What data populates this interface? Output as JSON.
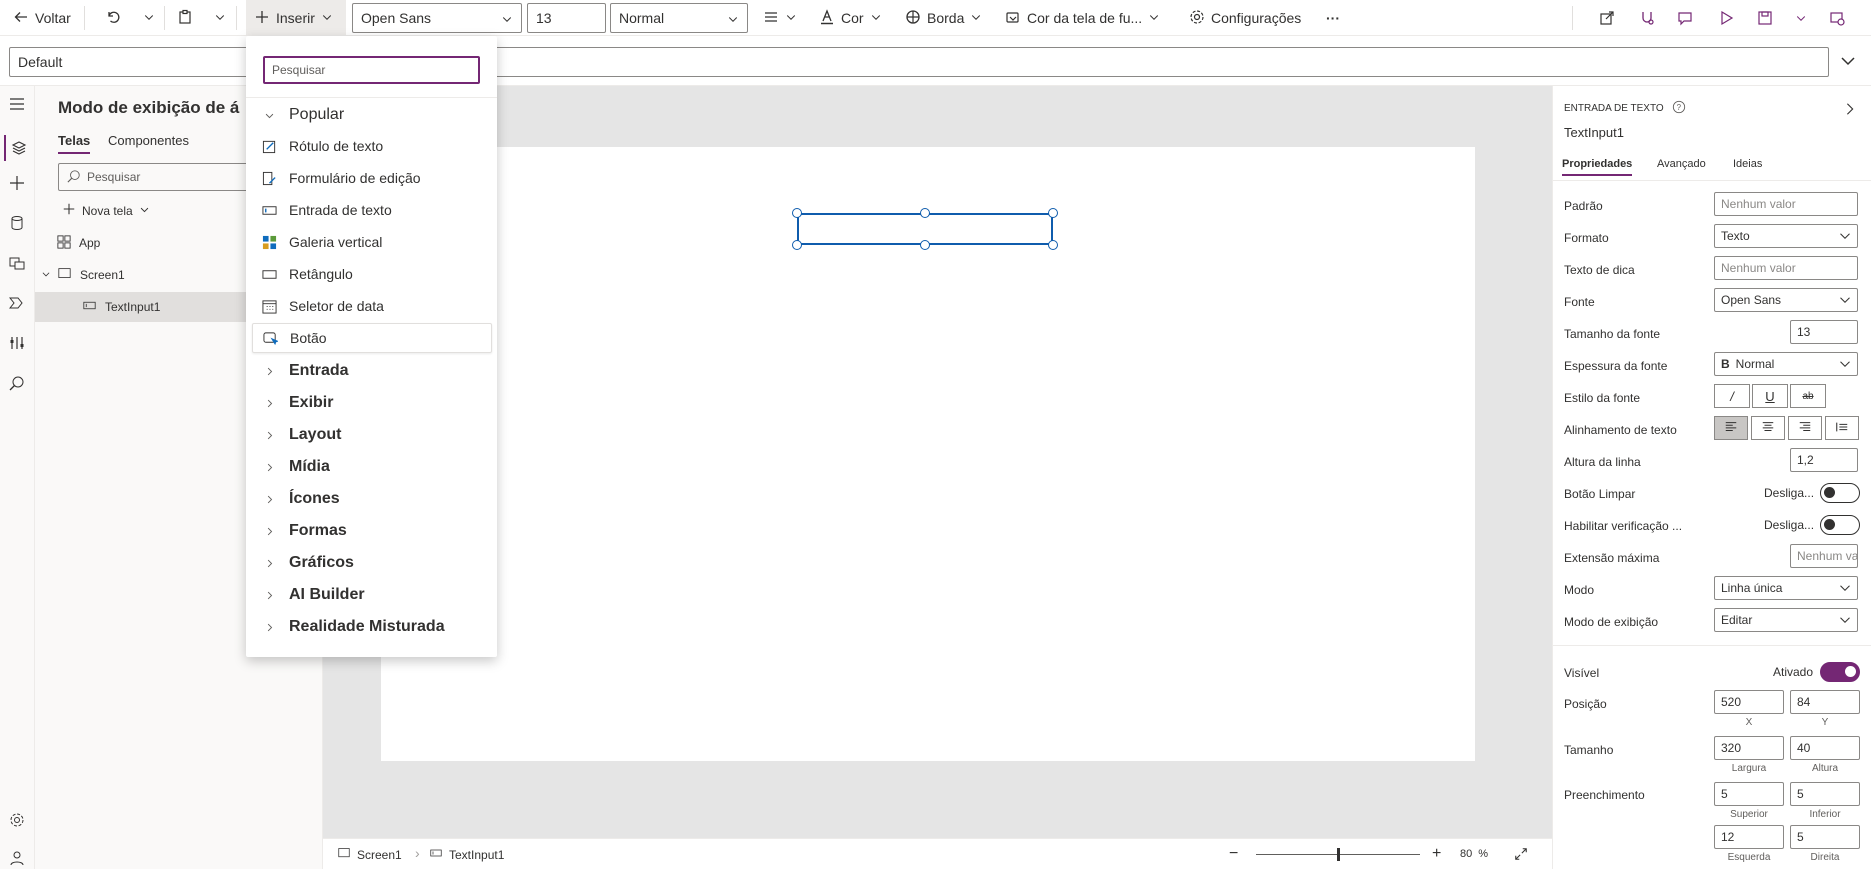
{
  "toolbar": {
    "back_label": "Voltar",
    "insert_label": "Inserir",
    "font_value": "Open Sans",
    "size_value": "13",
    "weight_value": "Normal",
    "color_label": "Cor",
    "border_label": "Borda",
    "fill_label": "Cor da tela de fu...",
    "settings_label": "Configurações",
    "more_label": "···"
  },
  "formula": {
    "value": "Default"
  },
  "tree": {
    "title": "Modo de exibição de á",
    "tabs": [
      "Telas",
      "Componentes"
    ],
    "search_placeholder": "Pesquisar",
    "new_screen_label": "Nova tela",
    "items": [
      {
        "label": "App"
      },
      {
        "label": "Screen1"
      },
      {
        "label": "TextInput1"
      }
    ]
  },
  "insert_menu": {
    "search_placeholder": "Pesquisar",
    "popular_label": "Popular",
    "popular_items": [
      {
        "label": "Rótulo de texto",
        "icon": "label-icon"
      },
      {
        "label": "Formulário de edição",
        "icon": "form-icon"
      },
      {
        "label": "Entrada de texto",
        "icon": "text-input-icon"
      },
      {
        "label": "Galeria vertical",
        "icon": "gallery-icon"
      },
      {
        "label": "Retângulo",
        "icon": "rectangle-icon"
      },
      {
        "label": "Seletor de data",
        "icon": "calendar-icon"
      },
      {
        "label": "Botão",
        "icon": "button-icon"
      }
    ],
    "categories": [
      "Entrada",
      "Exibir",
      "Layout",
      "Mídia",
      "Ícones",
      "Formas",
      "Gráficos",
      "AI Builder",
      "Realidade Misturada"
    ]
  },
  "status": {
    "screen_label": "Screen1",
    "control_label": "TextInput1",
    "zoom_value": "80",
    "zoom_unit": "%",
    "zoom_level": 0.5
  },
  "props": {
    "type_label": "ENTRADA DE TEXTO",
    "control_name": "TextInput1",
    "tabs": [
      "Propriedades",
      "Avançado",
      "Ideias"
    ],
    "rows": {
      "padrao": {
        "label": "Padrão",
        "value": "Nenhum valor"
      },
      "formato": {
        "label": "Formato",
        "value": "Texto"
      },
      "dica": {
        "label": "Texto de dica",
        "value": "Nenhum valor"
      },
      "fonte": {
        "label": "Fonte",
        "value": "Open Sans"
      },
      "tamanho_fonte": {
        "label": "Tamanho da fonte",
        "value": "13"
      },
      "espessura": {
        "label": "Espessura da fonte",
        "value": "Normal",
        "prefix": "B"
      },
      "estilo": {
        "label": "Estilo da fonte",
        "italic": "/",
        "underline": "U",
        "strike": "ab"
      },
      "alinhamento": {
        "label": "Alinhamento de texto"
      },
      "altura_linha": {
        "label": "Altura da linha",
        "value": "1,2"
      },
      "botao_limpar": {
        "label": "Botão Limpar",
        "state": "Desliga..."
      },
      "verificacao": {
        "label": "Habilitar verificação ...",
        "state": "Desliga..."
      },
      "extensao": {
        "label": "Extensão máxima",
        "value": "Nenhum val"
      },
      "modo": {
        "label": "Modo",
        "value": "Linha única"
      },
      "modo_exibicao": {
        "label": "Modo de exibição",
        "value": "Editar"
      },
      "visivel": {
        "label": "Visível",
        "state": "Ativado"
      },
      "posicao": {
        "label": "Posição",
        "x": "520",
        "y": "84",
        "x_caption": "X",
        "y_caption": "Y"
      },
      "tamanho": {
        "label": "Tamanho",
        "w": "320",
        "h": "40",
        "w_caption": "Largura",
        "h_caption": "Altura"
      },
      "preenchimento": {
        "label": "Preenchimento",
        "top": "5",
        "bottom": "5",
        "top_caption": "Superior",
        "bottom_caption": "Inferior",
        "left": "12",
        "right": "5",
        "left_caption": "Esquerda",
        "right_caption": "Direita"
      }
    }
  },
  "colors": {
    "accent": "#742774",
    "selection": "#0f5cad",
    "canvas_bg": "#e5e5e5"
  }
}
